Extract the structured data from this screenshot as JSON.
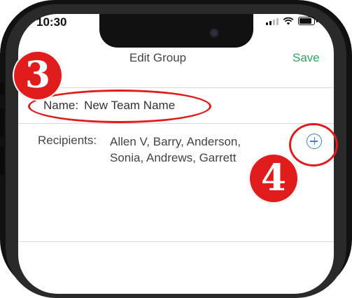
{
  "status_bar": {
    "time": "10:30"
  },
  "nav": {
    "title": "Edit Group",
    "save_label": "Save"
  },
  "form": {
    "name_label": "Name:",
    "name_value": "New Team Name",
    "recipients_label": "Recipients:",
    "recipients_line1": "Allen V, Barry, Anderson,",
    "recipients_line2": "Sonia, Andrews, Garrett"
  },
  "annotations": {
    "step_3": "3",
    "step_4": "4"
  },
  "colors": {
    "accent_green": "#2aa563",
    "accent_blue": "#3b7de0",
    "annotation_red": "#e01c1c"
  },
  "icons": [
    "add-circle-icon",
    "signal-icon",
    "wifi-icon",
    "battery-icon"
  ]
}
